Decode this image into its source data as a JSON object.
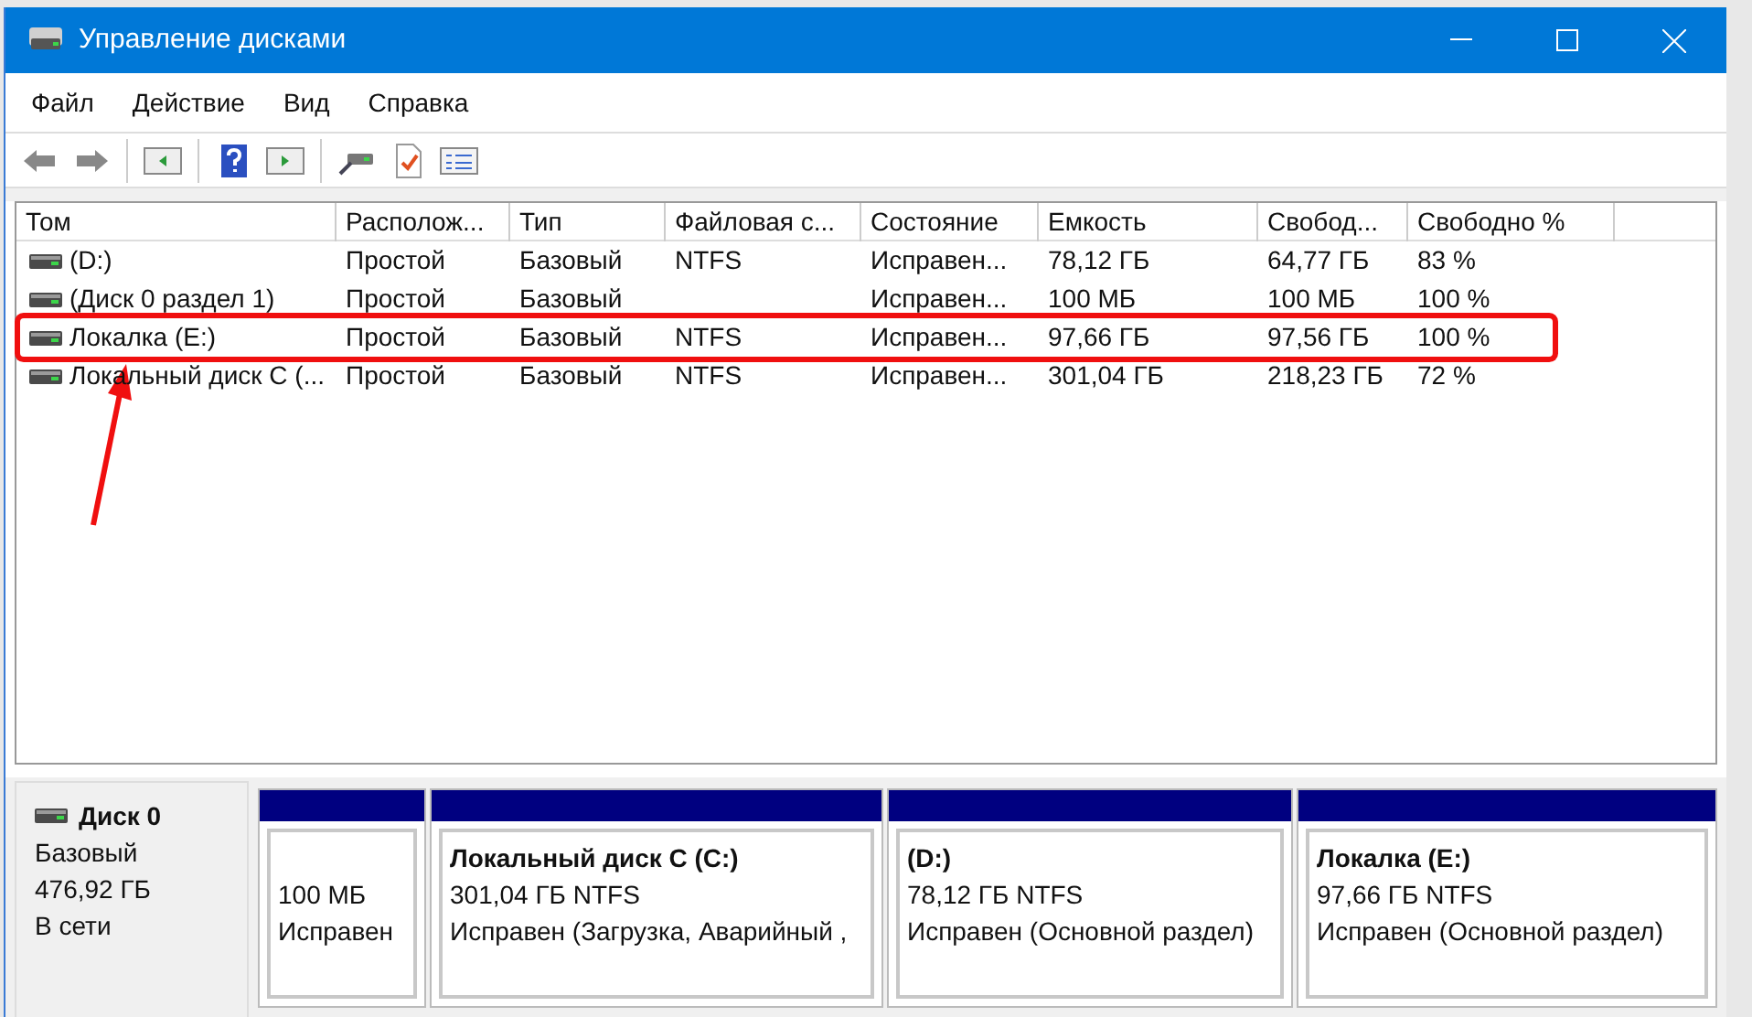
{
  "window": {
    "title": "Управление дисками"
  },
  "menu": [
    "Файл",
    "Действие",
    "Вид",
    "Справка"
  ],
  "table": {
    "columns": [
      "Том",
      "Располож...",
      "Тип",
      "Файловая с...",
      "Состояние",
      "Емкость",
      "Свобод...",
      "Свободно %"
    ],
    "rows": [
      {
        "cells": [
          "(D:)",
          "Простой",
          "Базовый",
          "NTFS",
          "Исправен...",
          "78,12 ГБ",
          "64,77 ГБ",
          "83 %"
        ],
        "highlighted": false
      },
      {
        "cells": [
          "(Диск 0 раздел 1)",
          "Простой",
          "Базовый",
          "",
          "Исправен...",
          "100 МБ",
          "100 МБ",
          "100 %"
        ],
        "highlighted": false
      },
      {
        "cells": [
          "Локалка (E:)",
          "Простой",
          "Базовый",
          "NTFS",
          "Исправен...",
          "97,66 ГБ",
          "97,56 ГБ",
          "100 %"
        ],
        "highlighted": true
      },
      {
        "cells": [
          "Локальный диск C (...",
          "Простой",
          "Базовый",
          "NTFS",
          "Исправен...",
          "301,04 ГБ",
          "218,23 ГБ",
          "72 %"
        ],
        "highlighted": false
      }
    ]
  },
  "disk": {
    "name": "Диск 0",
    "type": "Базовый",
    "size": "476,92 ГБ",
    "status": "В сети",
    "partitions": [
      {
        "size": "100 МБ",
        "status": "Исправен"
      },
      {
        "name": "Локальный диск C  (C:)",
        "size": "301,04 ГБ NTFS",
        "status": "Исправен (Загрузка, Аварийный ,"
      },
      {
        "name": "(D:)",
        "size": "78,12 ГБ NTFS",
        "status": "Исправен (Основной раздел)"
      },
      {
        "name": "Локалка  (E:)",
        "size": "97,66 ГБ NTFS",
        "status": "Исправен (Основной раздел)"
      }
    ]
  }
}
